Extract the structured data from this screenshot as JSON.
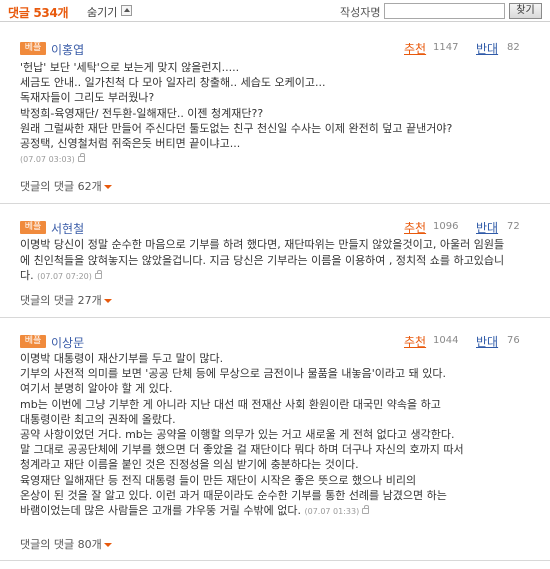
{
  "header": {
    "count_label": "댓글 534개",
    "hide_label": "숨기기",
    "author_search_label": "작성자명",
    "search_input_value": "",
    "search_button_label": "찾기"
  },
  "comments": [
    {
      "badge": "베플",
      "author": "이홍엽",
      "rec_label": "추천",
      "rec_count": "1147",
      "opp_label": "반대",
      "opp_count": "82",
      "lines": [
        "'헌납' 보단 '세탁'으로 보는게 맞지 않을런지.....",
        "세금도 안내.. 일가친척 다 모아 일자리 창출해.. 세습도 오케이고...",
        "독재자들이 그리도 부러웠나?",
        "박정희-육영재단/ 전두환-일해재단.. 이젠 청계재단??",
        "원래 그럴싸한 재단 만들어 주신다던 툴도없는 친구 천신일 수사는 이제 완전히 덮고 끝낸거야?",
        "공정택, 신영철처럼 쥐죽은듯 버티면 끝이냐고..."
      ],
      "timestamp": "(07.07 03:03)",
      "reply_toggle": "댓글의 댓글 62개"
    },
    {
      "badge": "베플",
      "author": "서현철",
      "rec_label": "추천",
      "rec_count": "1096",
      "opp_label": "반대",
      "opp_count": "72",
      "lines": [
        "이명박 당신이 정말 순수한 마음으로 기부를 하려 했다면, 재단따위는 만들지 않았을것이고, 아울러 임원들",
        "에 친인척들을 앉혀놓지는 않았을겁니다. 지금 당신은 기부라는 이름을 이용하여 , 정치적 쇼를 하고있습니",
        "다."
      ],
      "timestamp": "(07.07 07:20)",
      "reply_toggle": "댓글의 댓글 27개"
    },
    {
      "badge": "베플",
      "author": "이상문",
      "rec_label": "추천",
      "rec_count": "1044",
      "opp_label": "반대",
      "opp_count": "76",
      "lines": [
        "이명박 대통령이 재산기부를 두고 말이 많다.",
        "기부의 사전적 의미를 보면 '공공 단체 등에 무상으로 금전이나 물품을 내놓음'이라고 돼 있다.",
        "여기서 분명히 알아야 할 게 있다.",
        "mb는 이번에 그냥 기부한 게 아니라 지난 대선 때 전재산 사회 환원이란 대국민 약속을 하고",
        "대통령이란 최고의 권좌에 올랐다.",
        "공약 사항이었던 거다. mb는 공약을 이행할 의무가 있는 거고 새로울 게 전혀 없다고 생각한다.",
        "말 그대로 공공단체에 기부를 했으면 더 좋았을 걸 재단이다 뭐다 하며 더구나 자신의 호까지 따서",
        "청계라고 재단 이름을 붙인 것은 진정성을 의심 받기에 충분하다는 것이다.",
        "육영재단 일해재단 등 전직 대통령 들이 만든 재단이 시작은 좋은 뜻으로 했으나 비리의",
        "온상이 된 것을 잘 알고 있다. 이런 과거 때문이라도 순수한 기부를 통한 선례를 남겼으면 하는",
        "바램이었는데 많은 사람들은 고개를 갸우뚱 거릴 수밖에 없다."
      ],
      "timestamp": "(07.07 01:33)",
      "reply_toggle": "댓글의 댓글 80개"
    }
  ]
}
